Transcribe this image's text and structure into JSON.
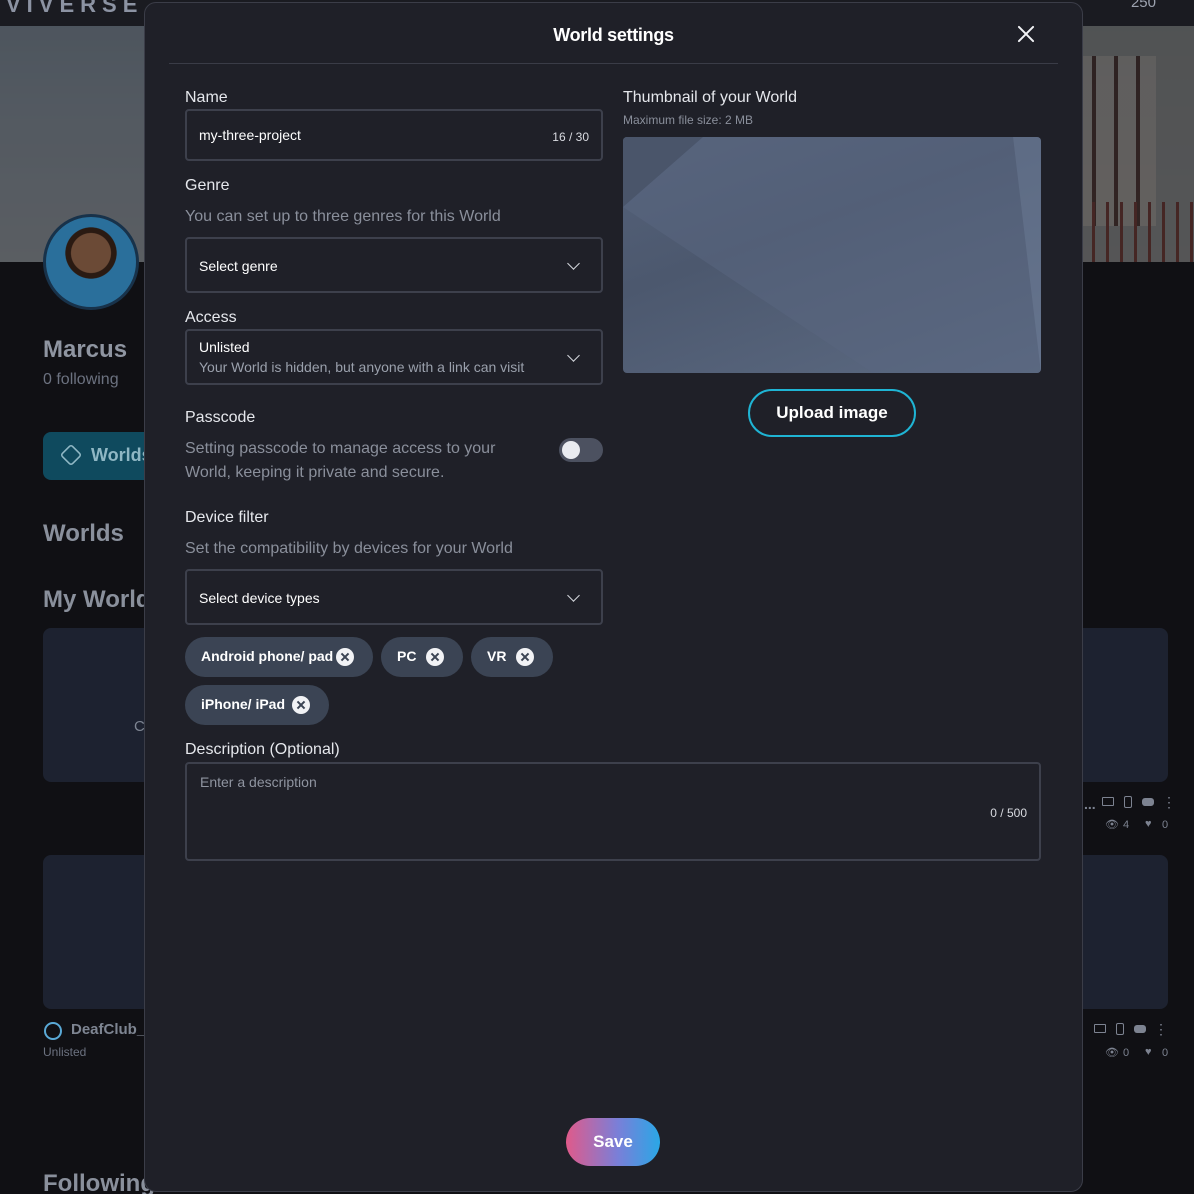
{
  "background": {
    "brand": "VIVERSE",
    "coins": "250",
    "profile_name": "Marcus",
    "following": "0 following",
    "worlds_button": "Worlds",
    "section_worlds": "Worlds",
    "section_my_worlds": "My World",
    "section_following": "Following",
    "card_title": "DeafClub_",
    "card_status": "Unlisted",
    "card_left_text": "C",
    "stats_card1": {
      "views": "4",
      "likes": "0"
    },
    "stats_card2": {
      "views": "0",
      "likes": "0"
    }
  },
  "modal": {
    "title": "World settings",
    "name": {
      "label": "Name",
      "value": "my-three-project",
      "counter": "16 / 30"
    },
    "genre": {
      "label": "Genre",
      "helper": "You can set up to three genres for this World",
      "placeholder": "Select genre"
    },
    "access": {
      "label": "Access",
      "value": "Unlisted",
      "description": "Your World is hidden, but anyone with a link can visit"
    },
    "passcode": {
      "label": "Passcode",
      "helper_line1": "Setting passcode to manage access to your",
      "helper_line2": "World, keeping it private and secure.",
      "enabled": false
    },
    "device_filter": {
      "label": "Device filter",
      "helper": "Set the compatibility by devices for your World",
      "placeholder": "Select device types",
      "chips": [
        "Android phone/ pad",
        "PC",
        "VR",
        "iPhone/ iPad"
      ]
    },
    "thumbnail": {
      "label": "Thumbnail of your World",
      "helper": "Maximum file size: 2 MB",
      "upload_label": "Upload image"
    },
    "description": {
      "label": "Description (Optional)",
      "placeholder": "Enter a description",
      "counter": "0 / 500"
    },
    "save_label": "Save"
  },
  "colors": {
    "accent": "#1fb4d4",
    "modal_bg": "#1f2028",
    "chip_bg": "#3b4454"
  }
}
